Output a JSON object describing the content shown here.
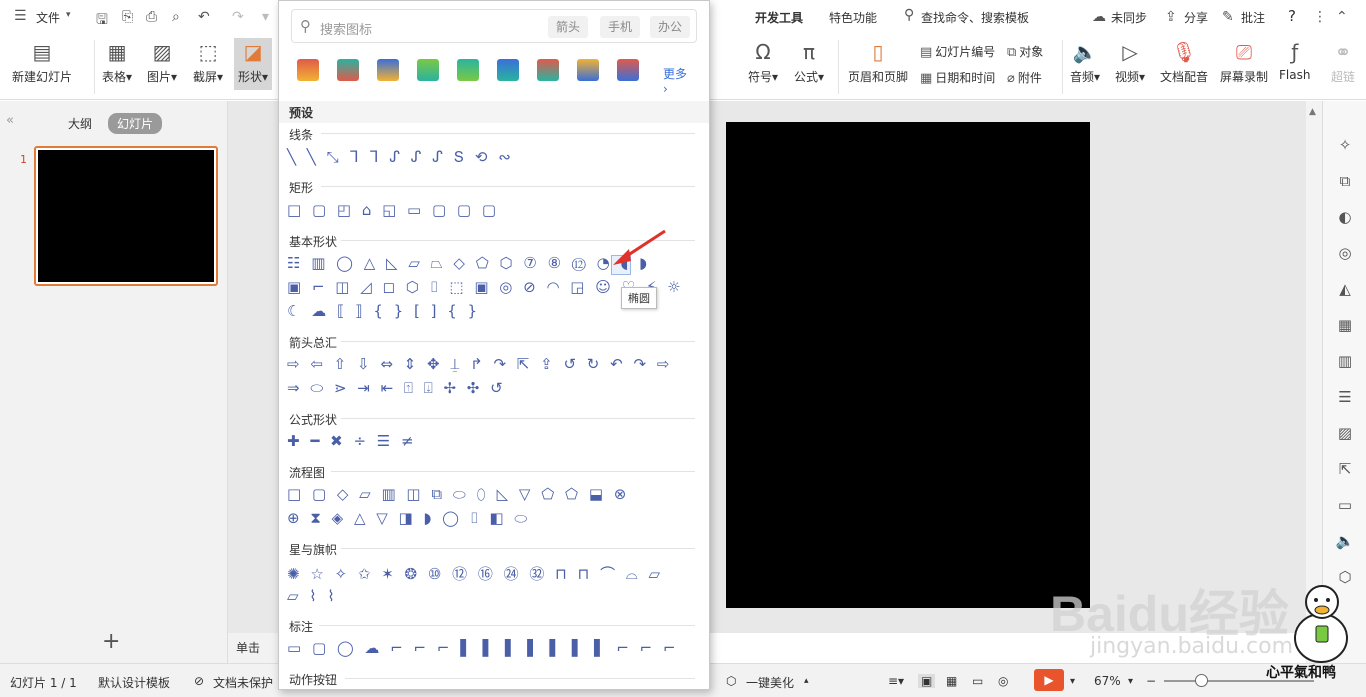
{
  "menubar": {
    "file": "文件",
    "dev_tools": "开发工具",
    "special": "特色功能",
    "search_cmd": "查找命令、搜索模板",
    "sync": "未同步",
    "share": "分享",
    "comment": "批注",
    "help": "?"
  },
  "ribbon": {
    "new_slide": "新建幻灯片",
    "table": "表格",
    "picture": "图片",
    "screenshot": "截屏",
    "shape": "形状",
    "symbol": "符号",
    "formula": "公式",
    "header_footer": "页眉和页脚",
    "slide_number": "幻灯片编号",
    "object": "对象",
    "date_time": "日期和时间",
    "attachment": "附件",
    "audio": "音频",
    "video": "视频",
    "doc_dubbing": "文档配音",
    "screen_record": "屏幕录制",
    "flash": "Flash",
    "hyperlink": "超链"
  },
  "left_panel": {
    "tab_outline": "大纲",
    "tab_slides": "幻灯片",
    "slide_number": "1"
  },
  "notes_label": "单击",
  "status": {
    "slide_pos": "幻灯片 1 / 1",
    "design": "默认设计模板",
    "protect": "文档未保护",
    "beautify": "一键美化",
    "zoom": "67%",
    "zoom_fraction": 0.25
  },
  "shape_panel": {
    "search_placeholder": "搜索图标",
    "tags": [
      "箭头",
      "手机",
      "办公"
    ],
    "more": "更多",
    "preset": "预设",
    "categories": {
      "lines": "线条",
      "rect": "矩形",
      "basic": "基本形状",
      "arrows": "箭头总汇",
      "formula": "公式形状",
      "flowchart": "流程图",
      "stars": "星与旗帜",
      "callouts": "标注",
      "action": "动作按钮"
    },
    "tooltip": "椭圆"
  },
  "watermark": {
    "brand": "Baidu经验",
    "url": "jingyan.baidu.com",
    "signature": "心平氣和鸭"
  },
  "colors": {
    "accent": "#e07b39",
    "play": "#e8552c",
    "shape_stroke": "#4a5fa8",
    "link": "#3a6fd8"
  }
}
